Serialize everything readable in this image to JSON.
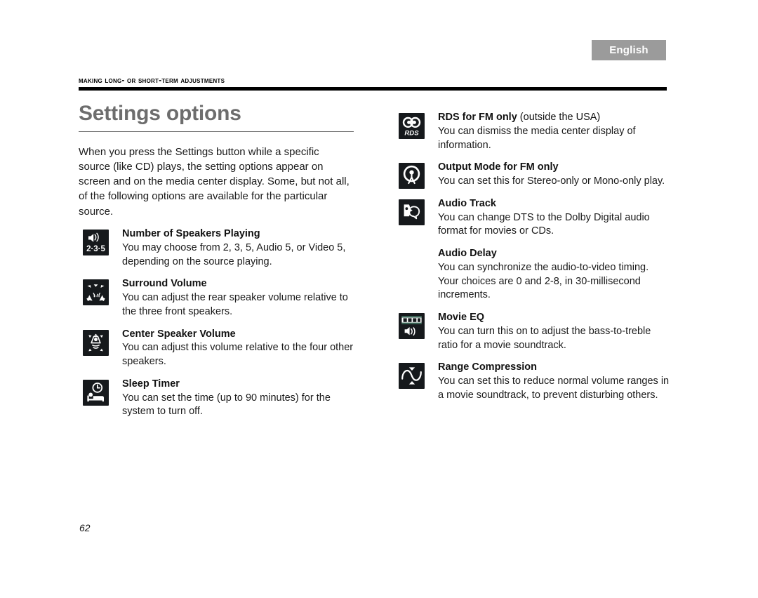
{
  "language_badge": "English",
  "running_head": "Making long- or short-term adjustments",
  "left_column": {
    "title": "Settings options",
    "intro": "When you press the Settings button while a specific source (like CD) plays, the setting options appear on screen and on the media center display. Some, but not all, of the following options are available for the particular source.",
    "options": [
      {
        "icon": "speakers-235-icon",
        "title": "Number of Speakers Playing",
        "title_suffix": "",
        "body": "You may choose from 2, 3, 5, Audio 5, or Video 5, depending on the source playing."
      },
      {
        "icon": "surround-volume-icon",
        "title": "Surround Volume",
        "title_suffix": "",
        "body": "You can adjust the rear speaker volume relative to the three front speakers."
      },
      {
        "icon": "center-speaker-icon",
        "title": "Center Speaker Volume",
        "title_suffix": "",
        "body": "You can adjust this volume relative to the four other speakers."
      },
      {
        "icon": "sleep-timer-icon",
        "title": "Sleep Timer",
        "title_suffix": "",
        "body": "You can set the time (up to 90 minutes) for the system to turn off."
      }
    ]
  },
  "right_column": {
    "options": [
      {
        "icon": "rds-icon",
        "title": "RDS for FM only",
        "title_suffix": " (outside the USA)",
        "body": "You can dismiss the media center display of information."
      },
      {
        "icon": "fm-antenna-icon",
        "title": "Output Mode for FM only",
        "title_suffix": "",
        "body": "You can set this for Stereo-only or Mono-only play."
      },
      {
        "icon": "audio-track-icon",
        "title": "Audio Track",
        "title_suffix": "",
        "body": "You can change DTS to the Dolby Digital audio format for movies or CDs."
      },
      {
        "icon": "none",
        "title": "Audio Delay",
        "title_suffix": "",
        "body": "You can synchronize the audio-to-video timing. Your choices are 0 and 2-8, in 30-millisecond increments."
      },
      {
        "icon": "movie-eq-icon",
        "title": "Movie EQ",
        "title_suffix": "",
        "body": "You can turn this on to adjust the bass-to-treble ratio for a movie soundtrack."
      },
      {
        "icon": "range-compression-icon",
        "title": "Range Compression",
        "title_suffix": "",
        "body": "You can set this to reduce normal volume ranges in a movie soundtrack, to prevent disturbing others."
      }
    ]
  },
  "page_number": "62",
  "colors": {
    "badge_background": "#9b9b9b",
    "title_gray": "#6d6d6d",
    "icon_background": "#16191c",
    "rule_black": "#000000"
  }
}
